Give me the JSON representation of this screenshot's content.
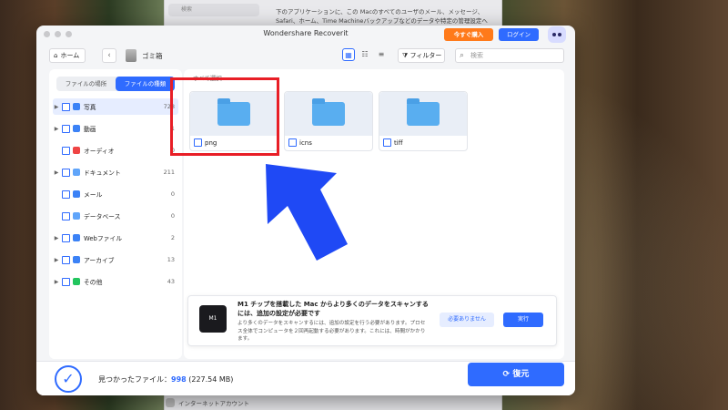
{
  "background_window": {
    "search_placeholder": "検索",
    "description": "下のアプリケーションに、この Macのすべてのユーザのメール、メッセージ、Safari、ホーム、Time Machineバックアップなどのデータや特定の管理設定へ",
    "bottom_item": "インターネットアカウント"
  },
  "window": {
    "title": "Wondershare Recoverit",
    "buy_label": "今すぐ購入",
    "login_label": "ログイン"
  },
  "toolbar": {
    "home_label": "ホーム",
    "crumb": "ゴミ箱",
    "filter_label": "フィルター",
    "search_placeholder": "検索"
  },
  "sidebar": {
    "tab_location": "ファイルの場所",
    "tab_type": "ファイルの種類",
    "items": [
      {
        "label": "写真",
        "count": "728",
        "color": "#3b82f6"
      },
      {
        "label": "動画",
        "count": "1",
        "color": "#3b82f6"
      },
      {
        "label": "オーディオ",
        "count": "0",
        "color": "#ef4444"
      },
      {
        "label": "ドキュメント",
        "count": "211",
        "color": "#60a5fa"
      },
      {
        "label": "メール",
        "count": "0",
        "color": "#3b82f6"
      },
      {
        "label": "データベース",
        "count": "0",
        "color": "#60a5fa"
      },
      {
        "label": "Webファイル",
        "count": "2",
        "color": "#3b82f6"
      },
      {
        "label": "アーカイブ",
        "count": "13",
        "color": "#3b82f6"
      },
      {
        "label": "その他",
        "count": "43",
        "color": "#22c55e"
      }
    ]
  },
  "content": {
    "select_all": "すべて選択",
    "folders": [
      {
        "name": "png"
      },
      {
        "name": "icns"
      },
      {
        "name": "tiff"
      }
    ]
  },
  "banner": {
    "chip_label": "M1",
    "title": "M1 チップを搭載した Mac からより多くのデータをスキャンするには、追加の設定が必要です",
    "desc": "より多くのデータをスキャンするには、追加の設定を行う必要があります。プロセス全体でコンピュータを２回再起動する必要があります。これには、時間がかかります。",
    "btn_no": "必要ありません",
    "btn_run": "実行"
  },
  "footer": {
    "found_label": "見つかったファイル：",
    "found_count": "998",
    "found_size": "(227.54 MB)",
    "restore_label": "復元"
  },
  "colors": {
    "accent": "#2f6bff",
    "highlight": "#e81e26",
    "arrow": "#1f49f5"
  }
}
